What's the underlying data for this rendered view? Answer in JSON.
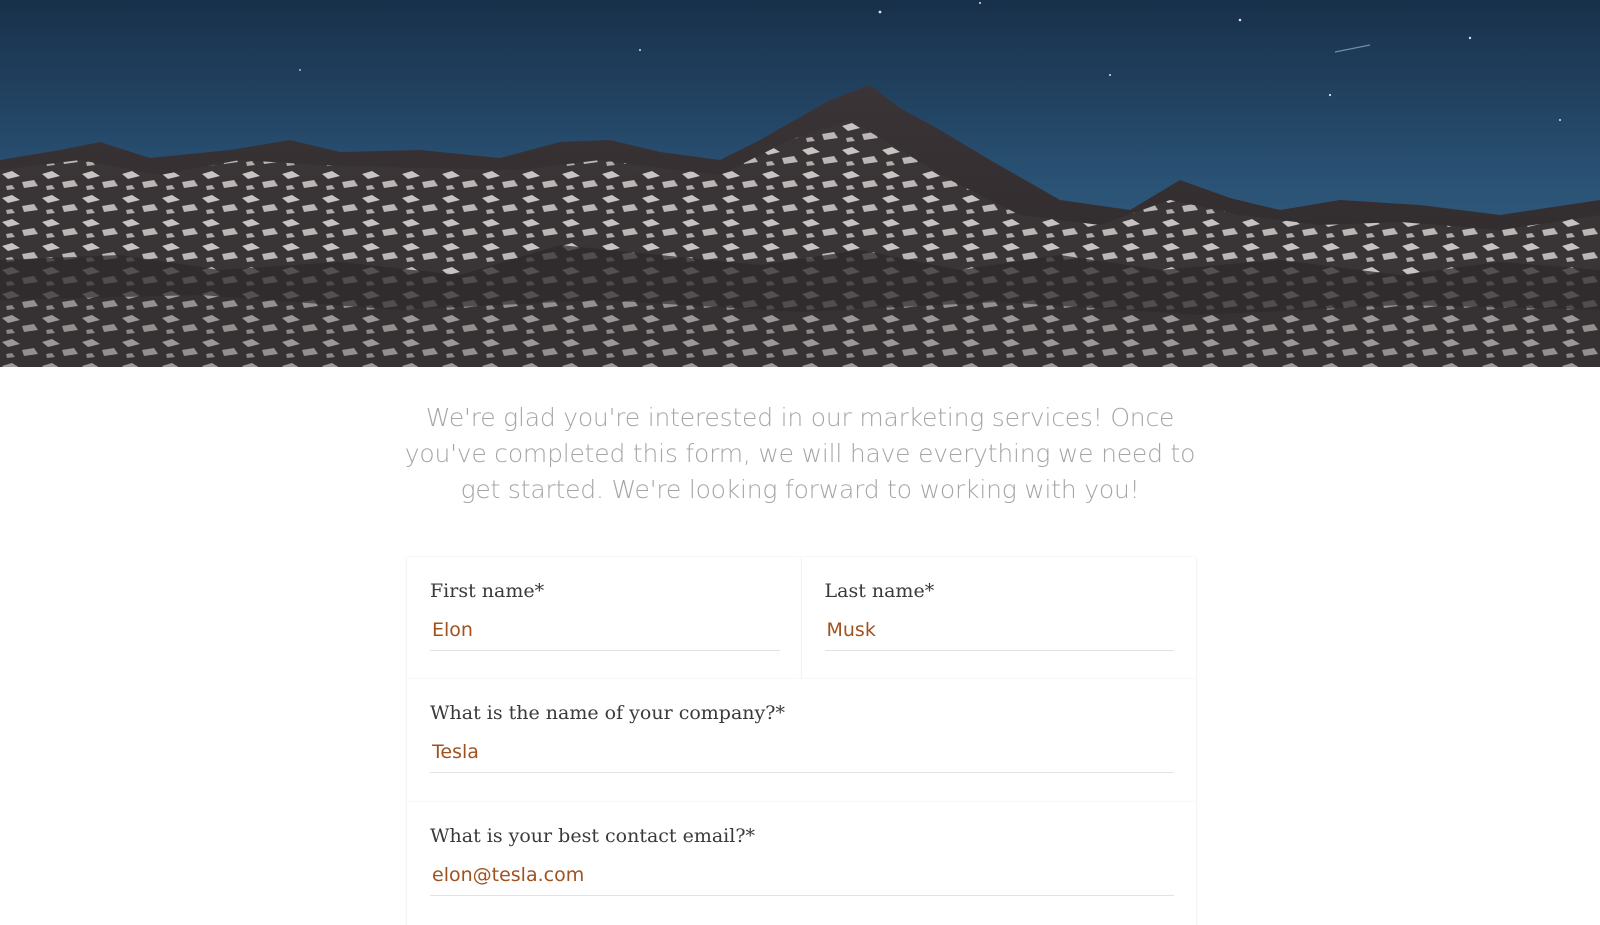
{
  "intro": {
    "text": "We're glad you're interested in our marketing services! Once you've completed this form, we will have everything we need to get started. We're looking forward to working with you!"
  },
  "form": {
    "first_name": {
      "label": "First name*",
      "value": "Elon"
    },
    "last_name": {
      "label": "Last name*",
      "value": "Musk"
    },
    "company": {
      "label": "What is the name of your company?*",
      "value": "Tesla"
    },
    "email": {
      "label": "What is your best contact email?*",
      "value": "elon@tesla.com"
    }
  },
  "colors": {
    "input_text": "#a0521e",
    "label_text": "#3a3a3a",
    "intro_text": "#a8a4a4",
    "sky": "#1e3a58"
  }
}
